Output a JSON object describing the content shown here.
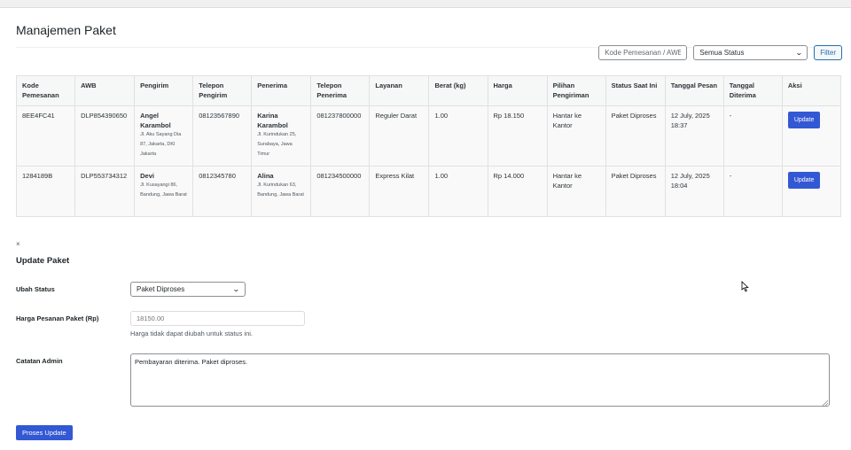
{
  "page": {
    "title": "Manajemen Paket"
  },
  "filters": {
    "search_placeholder": "Kode Pemesanan / AWB",
    "status_selected": "Semua Status",
    "filter_label": "Filter"
  },
  "table": {
    "headers": {
      "order_code": "Kode Pemesanan",
      "awb": "AWB",
      "sender": "Pengirim",
      "sender_phone": "Telepon Pengirim",
      "receiver": "Penerima",
      "receiver_phone": "Telepon Penerima",
      "service": "Layanan",
      "weight": "Berat (kg)",
      "price": "Harga",
      "delivery_option": "Pilihan Pengiriman",
      "current_status": "Status Saat Ini",
      "order_date": "Tanggal Pesan",
      "received_date": "Tanggal Diterima",
      "action": "Aksi"
    },
    "rows": [
      {
        "order_code": "8EE4FC41",
        "awb": "DLP854390650",
        "sender_name": "Angel Karambol",
        "sender_address": "Jl. Aku Sayang Dia 87, Jakarta, DKI Jakarta",
        "sender_phone": "08123567890",
        "receiver_name": "Karina Karambol",
        "receiver_address": "Jl. Kurindukan 25, Surabaya, Jawa Timur",
        "receiver_phone": "081237800000",
        "service": "Reguler Darat",
        "weight": "1.00",
        "price": "Rp 18.150",
        "delivery_option": "Hantar ke Kantor",
        "current_status": "Paket Diproses",
        "order_date": "12 July, 2025 18:37",
        "received_date": "-",
        "action_label": "Update"
      },
      {
        "order_code": "1284189B",
        "awb": "DLP553734312",
        "sender_name": "Devi",
        "sender_address": "Jl. Kusayangi 86, Bandung, Jawa Barat",
        "sender_phone": "0812345780",
        "receiver_name": "Alina",
        "receiver_address": "Jl. Kurindukan 63, Bandung, Jawa Barat",
        "receiver_phone": "081234500000",
        "service": "Express Kilat",
        "weight": "1.00",
        "price": "Rp 14.000",
        "delivery_option": "Hantar ke Kantor",
        "current_status": "Paket Diproses",
        "order_date": "12 July, 2025 18:04",
        "received_date": "-",
        "action_label": "Update"
      }
    ]
  },
  "update_form": {
    "close_glyph": "×",
    "title": "Update Paket",
    "status_label": "Ubah Status",
    "status_value": "Paket Diproses",
    "price_label": "Harga Pesanan Paket (Rp)",
    "price_placeholder": "18150.00",
    "price_hint": "Harga tidak dapat diubah untuk status ini.",
    "notes_label": "Catatan Admin",
    "notes_value": "Pembayaran diterima. Paket diproses.",
    "submit_label": "Proses Update"
  },
  "icons": {
    "select_chevron": "chevron-down-icon",
    "close": "close-icon",
    "cursor": "mouse-pointer-icon",
    "resize": "resize-grip-icon"
  },
  "colors": {
    "primary_button": "#3358d4",
    "link_blue": "#2271b1"
  }
}
